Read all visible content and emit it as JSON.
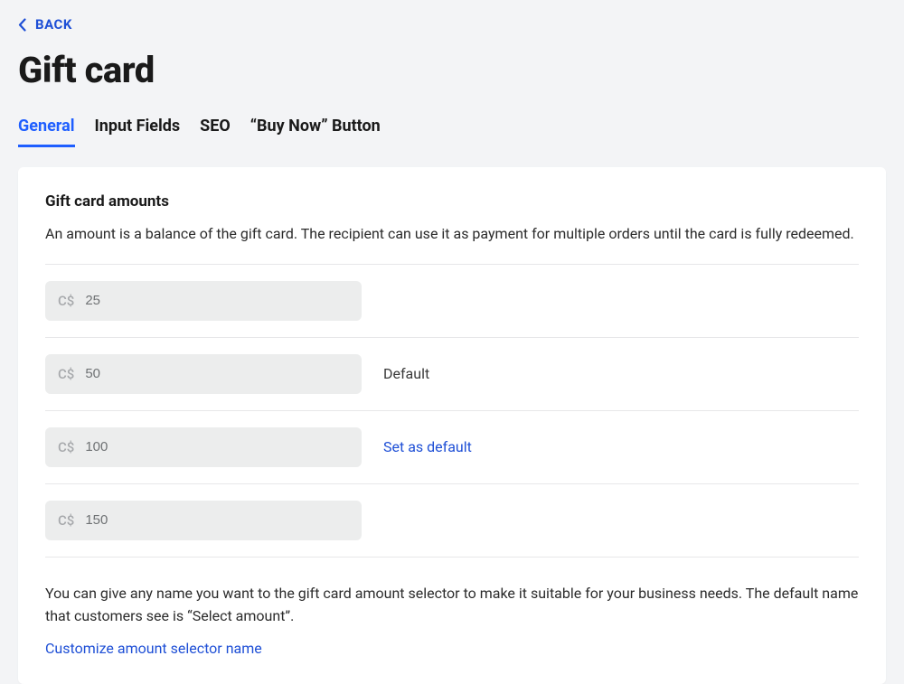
{
  "back_label": "BACK",
  "page_title": "Gift card",
  "tabs": [
    {
      "label": "General",
      "active": true
    },
    {
      "label": "Input Fields",
      "active": false
    },
    {
      "label": "SEO",
      "active": false
    },
    {
      "label": "“Buy Now” Button",
      "active": false
    }
  ],
  "section": {
    "title": "Gift card amounts",
    "description": "An amount is a balance of the gift card. The recipient can use it as payment for multiple orders until the card is fully redeemed."
  },
  "currency_prefix": "C$",
  "amounts": [
    {
      "value": "25",
      "action": ""
    },
    {
      "value": "50",
      "action": "Default"
    },
    {
      "value": "100",
      "action": "Set as default"
    },
    {
      "value": "150",
      "action": ""
    }
  ],
  "footer": {
    "description": "You can give any name you want to the gift card amount selector to make it suitable for your business needs. The default name that customers see is “Select amount”.",
    "customize_link": "Customize amount selector name"
  }
}
